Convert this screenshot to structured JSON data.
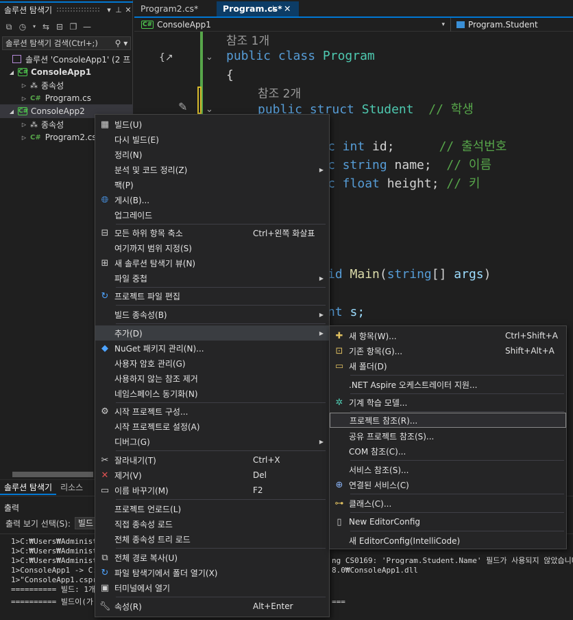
{
  "solution_explorer": {
    "title": "솔루션 탐색기",
    "search_placeholder": "솔루션 탐색기 검색(Ctrl+;)",
    "tree": [
      {
        "label": "솔루션 'ConsoleApp1' (2 프",
        "kind": "solution"
      },
      {
        "label": "ConsoleApp1",
        "kind": "project"
      },
      {
        "label": "종속성",
        "kind": "deps"
      },
      {
        "label": "Program.cs",
        "kind": "file"
      },
      {
        "label": "ConsoleApp2",
        "kind": "project"
      },
      {
        "label": "종속성",
        "kind": "deps"
      },
      {
        "label": "Program2.cs",
        "kind": "file"
      }
    ],
    "bottom_tabs": [
      "솔루션 탐색기",
      "리소스"
    ]
  },
  "editor": {
    "tabs": [
      {
        "label": "Program2.cs*"
      },
      {
        "label": "Program.cs*"
      }
    ],
    "nav_project": "ConsoleApp1",
    "nav_class": "Program.Student",
    "ref1": "참조 1개",
    "ref2": "참조 2개",
    "code": {
      "l1a": "public",
      "l1b": " class ",
      "l1c": "Program",
      "l2": "{",
      "l3a": "public",
      "l3b": " struct ",
      "l3c": "Student",
      "l3d": "  // 학생",
      "l4a": "c",
      "l4b": " int",
      "l4c": " id;",
      "l4d": "      // 출석번호",
      "l5a": "c",
      "l5b": " string",
      "l5c": " name;",
      "l5d": "  // 이름",
      "l6a": "c",
      "l6b": " float",
      "l6c": " height;",
      "l6d": " // 키",
      "l7a": "id ",
      "l7b": "Main",
      "l7c": "(",
      "l7d": "string",
      "l7e": "[] ",
      "l7f": "args",
      "l7g": ")",
      "l8a": "nt",
      "l8b": " s;"
    }
  },
  "output": {
    "title": "출력",
    "source_label": "출력 보기 선택(S):",
    "source_value": "빌드",
    "lines_left": [
      "1>C:₩Users₩Administra",
      "1>C:₩Users₩Administra",
      "1>C:₩Users₩Administra",
      "1>ConsoleApp1 -> C:₩",
      "1>\"ConsoleApp1.cspro",
      "========== 빌드: 1개",
      "========== 빌드이(가"
    ],
    "lines_right": [
      "ng CS0169: 'Program.Student.Name' 필드가 사용되지 않았습니다",
      "8.0₩ConsoleApp1.dll",
      "==="
    ]
  },
  "context_menu": {
    "items": [
      {
        "icon": "build-icon",
        "label": "빌드(U)",
        "shortcut": "",
        "submenu": false
      },
      {
        "icon": "",
        "label": "다시 빌드(E)",
        "shortcut": "",
        "submenu": false
      },
      {
        "icon": "",
        "label": "정리(N)",
        "shortcut": "",
        "submenu": false
      },
      {
        "icon": "",
        "label": "분석 및 코드 정리(Z)",
        "shortcut": "",
        "submenu": true
      },
      {
        "icon": "",
        "label": "팩(P)",
        "shortcut": "",
        "submenu": false
      },
      {
        "icon": "globe-icon",
        "label": "게시(B)...",
        "shortcut": "",
        "submenu": false
      },
      {
        "icon": "",
        "label": "업그레이드",
        "shortcut": "",
        "submenu": false
      },
      {
        "icon": "collapse-icon",
        "label": "모든 하위 항목 축소",
        "shortcut": "Ctrl+왼쪽 화살표",
        "submenu": false
      },
      {
        "icon": "",
        "label": "여기까지 범위 지정(S)",
        "shortcut": "",
        "submenu": false
      },
      {
        "icon": "new-view-icon",
        "label": "새 솔루션 탐색기 뷰(N)",
        "shortcut": "",
        "submenu": false
      },
      {
        "icon": "",
        "label": "파일 중첩",
        "shortcut": "",
        "submenu": true
      },
      {
        "icon": "edit-project-icon",
        "label": "프로젝트 파일 편집",
        "shortcut": "",
        "submenu": false
      },
      {
        "icon": "",
        "label": "빌드 종속성(B)",
        "shortcut": "",
        "submenu": true
      },
      {
        "icon": "",
        "label": "추가(D)",
        "shortcut": "",
        "submenu": true
      },
      {
        "icon": "nuget-icon",
        "label": "NuGet 패키지 관리(N)...",
        "shortcut": "",
        "submenu": false
      },
      {
        "icon": "",
        "label": "사용자 암호 관리(G)",
        "shortcut": "",
        "submenu": false
      },
      {
        "icon": "",
        "label": "사용하지 않는 참조 제거",
        "shortcut": "",
        "submenu": false
      },
      {
        "icon": "",
        "label": "네임스페이스 동기화(N)",
        "shortcut": "",
        "submenu": false
      },
      {
        "icon": "gear-icon",
        "label": "시작 프로젝트 구성...",
        "shortcut": "",
        "submenu": false
      },
      {
        "icon": "",
        "label": "시작 프로젝트로 설정(A)",
        "shortcut": "",
        "submenu": false
      },
      {
        "icon": "",
        "label": "디버그(G)",
        "shortcut": "",
        "submenu": true
      },
      {
        "icon": "scissors-icon",
        "label": "잘라내기(T)",
        "shortcut": "Ctrl+X",
        "submenu": false
      },
      {
        "icon": "delete-icon",
        "label": "제거(V)",
        "shortcut": "Del",
        "submenu": false
      },
      {
        "icon": "rename-icon",
        "label": "이름 바꾸기(M)",
        "shortcut": "F2",
        "submenu": false
      },
      {
        "icon": "",
        "label": "프로젝트 언로드(L)",
        "shortcut": "",
        "submenu": false
      },
      {
        "icon": "",
        "label": "직접 종속성 로드",
        "shortcut": "",
        "submenu": false
      },
      {
        "icon": "",
        "label": "전체 종속성 트리 로드",
        "shortcut": "",
        "submenu": false
      },
      {
        "icon": "copy-icon",
        "label": "전체 경로 복사(U)",
        "shortcut": "",
        "submenu": false
      },
      {
        "icon": "folder-open-icon",
        "label": "파일 탐색기에서 폴더 열기(X)",
        "shortcut": "",
        "submenu": false
      },
      {
        "icon": "terminal-icon",
        "label": "터미널에서 열기",
        "shortcut": "",
        "submenu": false
      },
      {
        "icon": "wrench-icon",
        "label": "속성(R)",
        "shortcut": "Alt+Enter",
        "submenu": false
      }
    ]
  },
  "add_submenu": {
    "items": [
      {
        "icon": "new-item-icon",
        "label": "새 항목(W)...",
        "shortcut": "Ctrl+Shift+A"
      },
      {
        "icon": "existing-item-icon",
        "label": "기존 항목(G)...",
        "shortcut": "Shift+Alt+A"
      },
      {
        "icon": "new-folder-icon",
        "label": "새 폴더(D)",
        "shortcut": ""
      },
      {
        "icon": "",
        "label": ".NET Aspire 오케스트레이터 지원...",
        "shortcut": ""
      },
      {
        "icon": "ml-model-icon",
        "label": "기계 학습 모델...",
        "shortcut": ""
      },
      {
        "icon": "",
        "label": "프로젝트 참조(R)...",
        "shortcut": ""
      },
      {
        "icon": "",
        "label": "공유 프로젝트 참조(S)...",
        "shortcut": ""
      },
      {
        "icon": "",
        "label": "COM 참조(C)...",
        "shortcut": ""
      },
      {
        "icon": "",
        "label": "서비스 참조(S)...",
        "shortcut": ""
      },
      {
        "icon": "connected-service-icon",
        "label": "연결된 서비스(C)",
        "shortcut": ""
      },
      {
        "icon": "class-icon",
        "label": "클래스(C)...",
        "shortcut": ""
      },
      {
        "icon": "editorconfig-icon",
        "label": "New EditorConfig",
        "shortcut": ""
      },
      {
        "icon": "",
        "label": "새 EditorConfig(IntelliCode)",
        "shortcut": ""
      }
    ]
  }
}
